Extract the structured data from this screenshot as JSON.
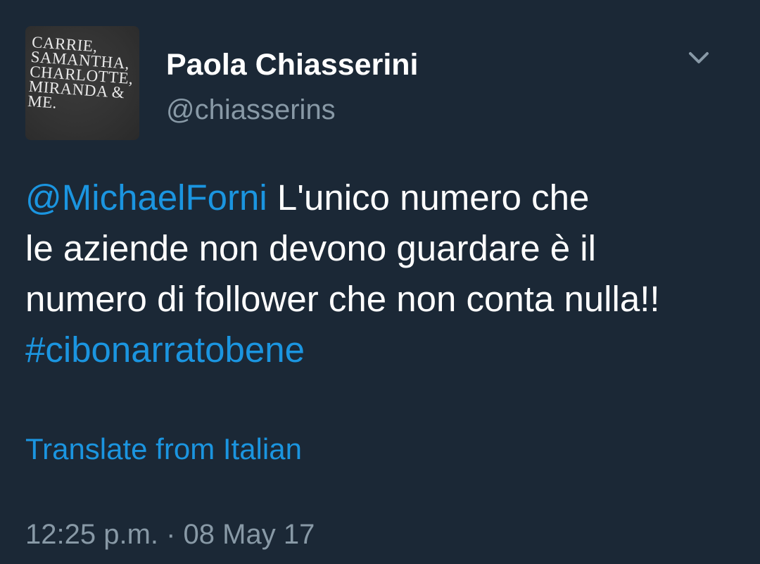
{
  "user": {
    "display_name": "Paola Chiasserini",
    "handle": "@chiasserins",
    "avatar_lines": [
      "CARRIE,",
      "SAMANTHA,",
      "CHARLOTTE,",
      "MIRANDA &",
      "ME."
    ]
  },
  "tweet": {
    "mention": "@MichaelForni",
    "text_line1": " L'unico numero che",
    "text_line2": "le aziende non devono guardare è il",
    "text_line3": "numero di follower che non conta nulla!!",
    "hashtag": "#cibonarratobene"
  },
  "translate_label": "Translate from Italian",
  "timestamp": "12:25 p.m. · 08 May 17",
  "icons": {
    "menu": "chevron-down-icon"
  },
  "colors": {
    "background": "#1b2836",
    "link": "#1b95e0",
    "secondary_text": "#8899a6",
    "primary_text": "#ffffff"
  }
}
